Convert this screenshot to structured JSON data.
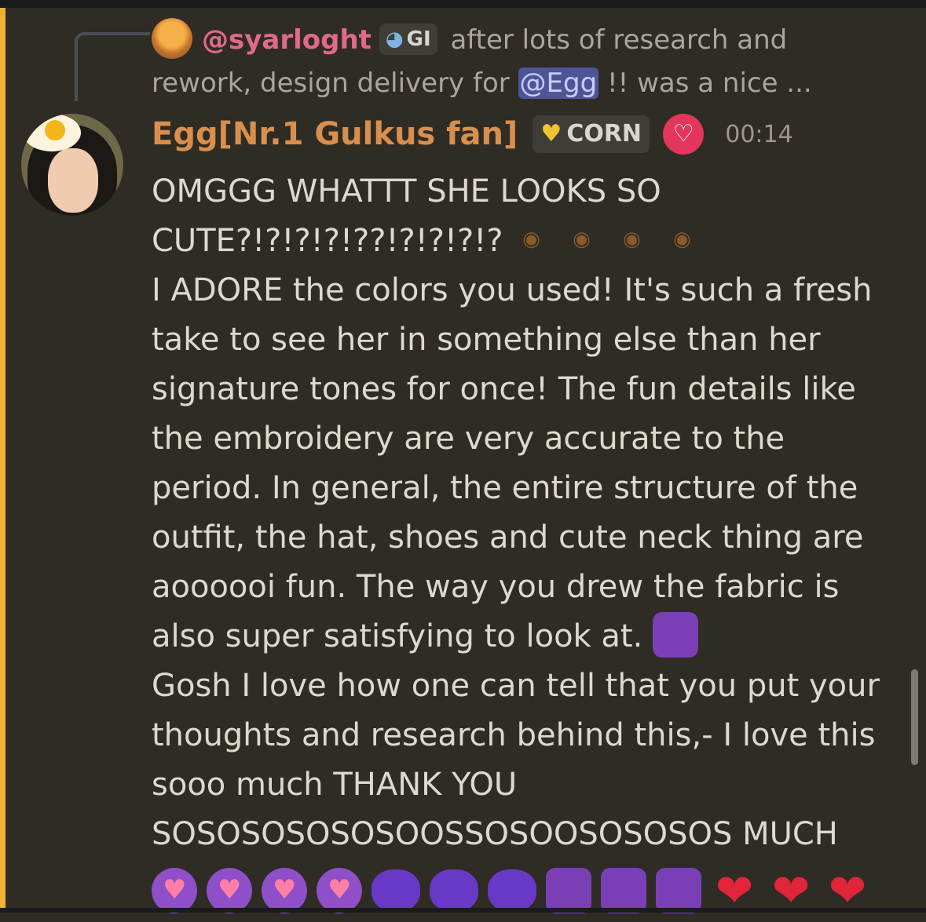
{
  "reply": {
    "author": "@syarloght",
    "tag": "GI",
    "text_1": "after lots of research and",
    "text_2": "rework, design delivery for",
    "mention": "@Egg",
    "text_3": "!! was a nice ..."
  },
  "message": {
    "author": "Egg[Nr.1 Gulkus fan]",
    "role_badge": "CORN",
    "timestamp": "00:14",
    "lines": [
      "OMGGG WHATTT SHE LOOKS SO",
      "CUTE?!?!?!?!??!?!?!?!?",
      "I ADORE the colors you used! It's such a fresh",
      "take to see her in something else than her",
      "signature tones for once! The fun details like",
      "the embroidery are very accurate to the",
      "period. In general, the entire structure of the",
      "outfit, the hat, shoes and cute neck thing are",
      "aoooooi fun. The way you drew the fabric is",
      "also super satisfying to look at.",
      "Gosh I love how one can tell that you put your",
      "thoughts and research behind this,- I love this",
      "sooo much THANK YOU",
      "SOSOSOSOSOSOOSSOSOOSOSOSOS MUCH"
    ],
    "buffalo_emojis": [
      "buffalo-emoji",
      "buffalo-emoji",
      "buffalo-emoji",
      "buffalo-emoji"
    ],
    "inline_emoji": "crying-creature-emoji",
    "emoji_row": [
      "heart-eyes-emoji",
      "heart-eyes-emoji",
      "heart-eyes-emoji",
      "heart-eyes-emoji",
      "wiggle-emoji",
      "wiggle-emoji",
      "wiggle-emoji",
      "crying-creature-emoji",
      "crying-creature-emoji",
      "crying-creature-emoji",
      "red-heart-emoji",
      "red-heart-emoji",
      "red-heart-emoji"
    ]
  },
  "colors": {
    "background": "#2e2c24",
    "highlight": "#f0b232",
    "author": "#d88f4e",
    "reply_author": "#e0698d",
    "mention_bg": "#4e5596"
  }
}
